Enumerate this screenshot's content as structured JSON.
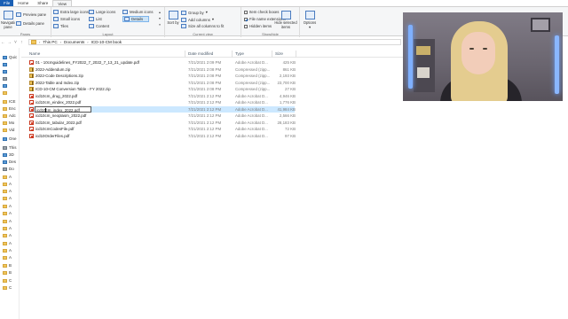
{
  "ribbon_tabs": [
    "File",
    "Home",
    "Share",
    "View"
  ],
  "ribbon": {
    "panes": {
      "navigation_pane": "Navigation pane",
      "preview_pane": "Preview pane",
      "details_pane": "Details pane",
      "label": "Panes"
    },
    "layout": {
      "items": [
        "Extra large icons",
        "Large icons",
        "Medium icons",
        "Small icons",
        "List",
        "Details",
        "Tiles",
        "Content"
      ],
      "selected": "Details",
      "label": "Layout"
    },
    "current_view": {
      "sort_by": "Sort by",
      "group_by": "Group by",
      "add_columns": "Add columns",
      "size_all_columns": "Size all columns to fit",
      "label": "Current view"
    },
    "show_hide": {
      "item_check_boxes": {
        "label": "Item check boxes",
        "checked": false
      },
      "file_name_extensions": {
        "label": "File name extensions",
        "checked": true
      },
      "hidden_items": {
        "label": "Hidden items",
        "checked": false
      },
      "hide_selected": "Hide selected items",
      "label": "Show/hide"
    },
    "options": "Options"
  },
  "address": {
    "parts": [
      "This PC",
      "Documents",
      "ICD-10-CM book"
    ]
  },
  "nav_pane": {
    "items": [
      "Quic",
      "",
      "",
      "",
      "",
      "",
      "ICE",
      "Enc",
      "Adc",
      "Mo",
      "Vid",
      "One",
      "This",
      "3D",
      "Des",
      "Do",
      "A",
      "A",
      "A",
      "A",
      "A",
      "A",
      "A",
      "A",
      "A",
      "A",
      "A",
      "A",
      "B",
      "B",
      "C",
      "C"
    ]
  },
  "columns": {
    "name": "Name",
    "date": "Date modified",
    "type": "Type",
    "size": "Size"
  },
  "files": [
    {
      "name": "01 - 10cmguidelines_FY2022_7_2022_7_13_21_update.pdf",
      "date": "7/21/2021 2:09 PM",
      "type": "Adobe Acrobat D...",
      "size": "425 KB",
      "icon": "pdf"
    },
    {
      "name": "2022-Addendum.zip",
      "date": "7/21/2021 2:08 PM",
      "type": "Compressed (zipp...",
      "size": "861 KB",
      "icon": "zip"
    },
    {
      "name": "2022-Code Descriptions.zip",
      "date": "7/21/2021 2:08 PM",
      "type": "Compressed (zipp...",
      "size": "2,193 KB",
      "icon": "zip"
    },
    {
      "name": "2022-Table and Index.zip",
      "date": "7/21/2021 2:08 PM",
      "type": "Compressed (zipp...",
      "size": "23,700 KB",
      "icon": "zip"
    },
    {
      "name": "ICD-10-CM Conversion Table - FY 2022.zip",
      "date": "7/21/2021 2:08 PM",
      "type": "Compressed (zipp...",
      "size": "27 KB",
      "icon": "zip"
    },
    {
      "name": "icd10cm_drug_2022.pdf",
      "date": "7/21/2021 2:12 PM",
      "type": "Adobe Acrobat D...",
      "size": "4,946 KB",
      "icon": "pdf"
    },
    {
      "name": "icd10cm_eindex_2022.pdf",
      "date": "7/21/2021 2:12 PM",
      "type": "Adobe Acrobat D...",
      "size": "1,776 KB",
      "icon": "pdf"
    },
    {
      "name": "icd10cm_index_2022.pdf",
      "date": "7/21/2021 2:12 PM",
      "type": "Adobe Acrobat D...",
      "size": "41,984 KB",
      "icon": "pdf",
      "selected": true,
      "renaming": true
    },
    {
      "name": "icd10cm_neoplasm_2022.pdf",
      "date": "7/21/2021 2:12 PM",
      "type": "Adobe Acrobat D...",
      "size": "2,566 KB",
      "icon": "pdf"
    },
    {
      "name": "icd10cm_tabular_2022.pdf",
      "date": "7/21/2021 2:12 PM",
      "type": "Adobe Acrobat D...",
      "size": "28,183 KB",
      "icon": "pdf"
    },
    {
      "name": "icd10cmCodesFile.pdf",
      "date": "7/21/2021 2:12 PM",
      "type": "Adobe Acrobat D...",
      "size": "72 KB",
      "icon": "pdf"
    },
    {
      "name": "icd10OrderFiles.pdf",
      "date": "7/21/2021 2:12 PM",
      "type": "Adobe Acrobat D...",
      "size": "97 KB",
      "icon": "pdf"
    }
  ],
  "colors": {
    "accent": "#1a5fb4",
    "selection": "#cce8ff"
  }
}
